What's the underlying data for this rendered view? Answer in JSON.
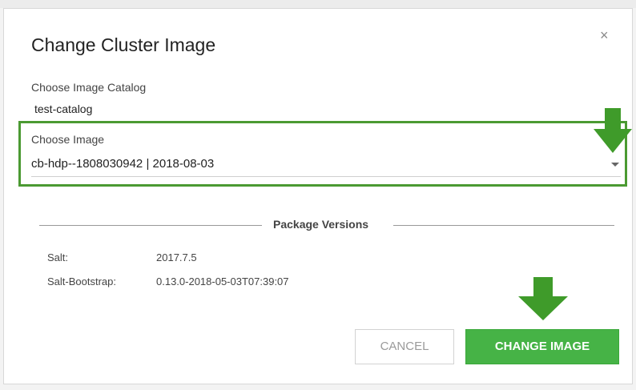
{
  "modal": {
    "title": "Change Cluster Image",
    "close_glyph": "×"
  },
  "catalog": {
    "label": "Choose Image Catalog",
    "value": "test-catalog"
  },
  "image": {
    "label": "Choose Image",
    "selected": "cb-hdp--1808030942 | 2018-08-03"
  },
  "package_versions": {
    "title": "Package Versions",
    "rows": [
      {
        "name": "Salt:",
        "version": "2017.7.5"
      },
      {
        "name": "Salt-Bootstrap:",
        "version": "0.13.0-2018-05-03T07:39:07"
      }
    ]
  },
  "buttons": {
    "cancel": "CANCEL",
    "change": "CHANGE IMAGE"
  },
  "colors": {
    "accent_green": "#46b346",
    "highlight_green": "#4b9a32",
    "arrow_green": "#3f9b2a"
  },
  "icons": {
    "close": "close-icon",
    "caret": "chevron-down-icon",
    "annotation": "arrow-down-icon"
  }
}
